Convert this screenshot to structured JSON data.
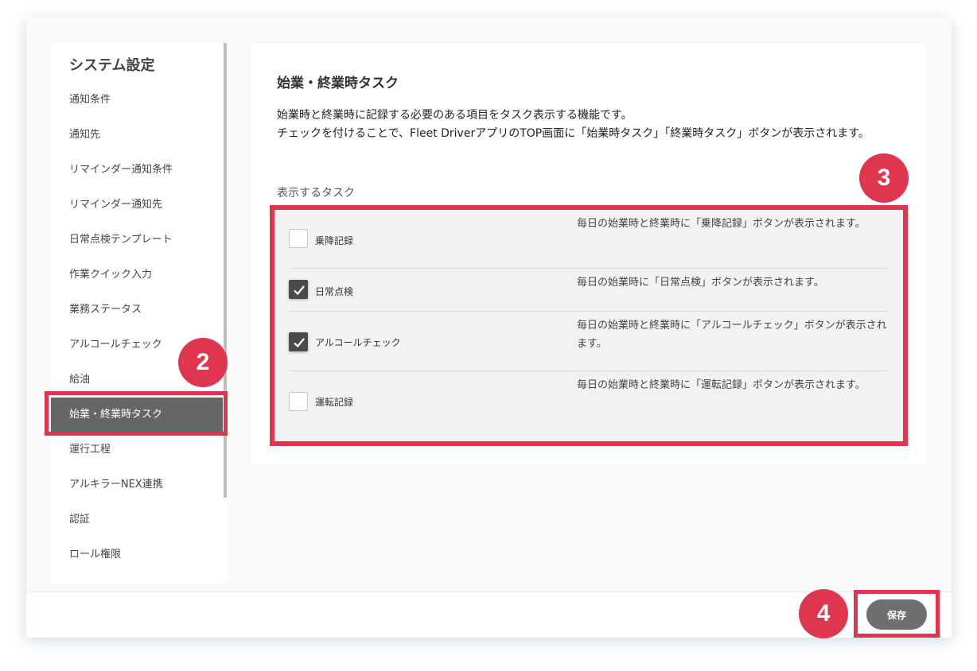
{
  "sidebar": {
    "title": "システム設定",
    "items": [
      {
        "label": "通知条件",
        "active": false
      },
      {
        "label": "通知先",
        "active": false
      },
      {
        "label": "リマインダー通知条件",
        "active": false
      },
      {
        "label": "リマインダー通知先",
        "active": false
      },
      {
        "label": "日常点検テンプレート",
        "active": false
      },
      {
        "label": "作業クイック入力",
        "active": false
      },
      {
        "label": "業務ステータス",
        "active": false
      },
      {
        "label": "アルコールチェック",
        "active": false
      },
      {
        "label": "給油",
        "active": false
      },
      {
        "label": "始業・終業時タスク",
        "active": true
      },
      {
        "label": "運行工程",
        "active": false
      },
      {
        "label": "アルキラーNEX連携",
        "active": false
      },
      {
        "label": "認証",
        "active": false
      },
      {
        "label": "ロール権限",
        "active": false
      }
    ]
  },
  "main": {
    "title": "始業・終業時タスク",
    "description_line1": "始業時と終業時に記録する必要のある項目をタスク表示する機能です。",
    "description_line2": "チェックを付けることで、Fleet DriverアプリのTOP画面に「始業時タスク」「終業時タスク」ボタンが表示されます。",
    "section_label": "表示するタスク",
    "tasks": [
      {
        "name": "乗降記録",
        "checked": false,
        "description": "毎日の始業時と終業時に「乗降記録」ボタンが表示されます。"
      },
      {
        "name": "日常点検",
        "checked": true,
        "description": "毎日の始業時に「日常点検」ボタンが表示されます。"
      },
      {
        "name": "アルコールチェック",
        "checked": true,
        "description": "毎日の始業時と終業時に「アルコールチェック」ボタンが表示されます。"
      },
      {
        "name": "運転記録",
        "checked": false,
        "description": "毎日の始業時と終業時に「運転記録」ボタンが表示されます。"
      }
    ]
  },
  "footer": {
    "save_label": "保存"
  },
  "annotations": {
    "badge_2": "2",
    "badge_3": "3",
    "badge_4": "4"
  },
  "colors": {
    "highlight": "#e0354f",
    "active_item": "#666666",
    "checkbox_checked": "#4a4a4a",
    "save_button": "#6f6f6f"
  }
}
